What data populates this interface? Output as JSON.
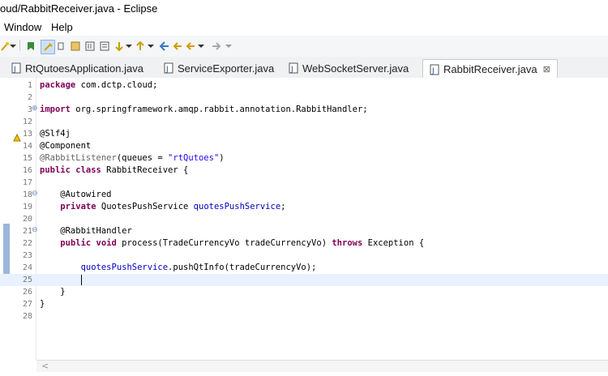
{
  "window": {
    "title": "oud/RabbitReceiver.java - Eclipse"
  },
  "menu": {
    "items": [
      "Window",
      "Help"
    ]
  },
  "toolbar": {
    "icons": [
      "wand-icon",
      "dropdown-arrow-icon",
      "bookmark-icon",
      "toggle-mark-icon",
      "annotation-icon",
      "block-select-icon",
      "show-whitespace-icon",
      "pin-icon",
      "next-annotation-icon",
      "prev-annotation-icon",
      "back-icon",
      "forward-icon"
    ]
  },
  "tabs": [
    {
      "label": "RtQutoesApplication.java",
      "active": false
    },
    {
      "label": "ServiceExporter.java",
      "active": false
    },
    {
      "label": "WebSocketServer.java",
      "active": false
    },
    {
      "label": "RabbitReceiver.java",
      "active": true,
      "close": "⊠"
    }
  ],
  "editor": {
    "lines": [
      {
        "num": "1",
        "code": "package com.dctp.cloud;"
      },
      {
        "num": "2",
        "code": ""
      },
      {
        "num": "3",
        "code": "import org.springframework.amqp.rabbit.annotation.RabbitHandler;"
      },
      {
        "num": "12",
        "code": ""
      },
      {
        "num": "13",
        "code": "@Slf4j"
      },
      {
        "num": "14",
        "code": "@Component"
      },
      {
        "num": "15",
        "code": "@RabbitListener(queues = \"rtQutoes\")"
      },
      {
        "num": "16",
        "code": "public class RabbitReceiver {"
      },
      {
        "num": "17",
        "code": ""
      },
      {
        "num": "18",
        "code": "    @Autowired"
      },
      {
        "num": "19",
        "code": "    private QuotesPushService quotesPushService;"
      },
      {
        "num": "20",
        "code": ""
      },
      {
        "num": "21",
        "code": "    @RabbitHandler"
      },
      {
        "num": "22",
        "code": "    public void process(TradeCurrencyVo tradeCurrencyVo) throws Exception {"
      },
      {
        "num": "23",
        "code": ""
      },
      {
        "num": "24",
        "code": "        quotesPushService.pushQtInfo(tradeCurrencyVo);"
      },
      {
        "num": "25",
        "code": "        "
      },
      {
        "num": "26",
        "code": "    }"
      },
      {
        "num": "27",
        "code": "}"
      },
      {
        "num": "28",
        "code": ""
      }
    ],
    "scroll_hint": "<"
  }
}
